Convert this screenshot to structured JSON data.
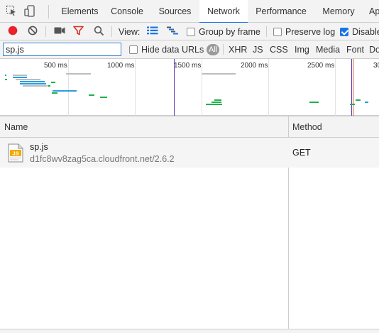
{
  "tabs": [
    {
      "label": "Elements",
      "active": false
    },
    {
      "label": "Console",
      "active": false
    },
    {
      "label": "Sources",
      "active": false
    },
    {
      "label": "Network",
      "active": true
    },
    {
      "label": "Performance",
      "active": false
    },
    {
      "label": "Memory",
      "active": false
    },
    {
      "label": "Ap",
      "active": false
    }
  ],
  "toolbar": {
    "record_icon": "record-icon",
    "clear_icon": "clear-icon",
    "camera_icon": "camera-icon",
    "filter_icon": "filter-icon",
    "search_icon": "search-icon",
    "view_label": "View:",
    "group_by_frame": {
      "label": "Group by frame",
      "checked": false
    },
    "preserve_log": {
      "label": "Preserve log",
      "checked": false
    },
    "disable_cache": {
      "label": "Disable",
      "checked": true
    }
  },
  "filter": {
    "value": "sp.js",
    "hide_data_urls": {
      "label": "Hide data URLs",
      "checked": false
    },
    "types": [
      "All",
      "XHR",
      "JS",
      "CSS",
      "Img",
      "Media",
      "Font",
      "Doc"
    ]
  },
  "overview": {
    "ticks": [
      "500 ms",
      "1000 ms",
      "1500 ms",
      "2000 ms",
      "2500 ms",
      "30"
    ]
  },
  "table": {
    "headers": {
      "name": "Name",
      "method": "Method"
    },
    "rows": [
      {
        "name": "sp.js",
        "path": "d1fc8wv8zag5ca.cloudfront.net/2.6.2",
        "method": "GET",
        "icon": "js-file-icon"
      }
    ]
  },
  "colors": {
    "accent": "#1a73e8",
    "record": "#e8232a",
    "filter": "#d93025",
    "bar_blue": "#2a9de0",
    "bar_green": "#21b14c",
    "marker_purple": "#5b38b2",
    "marker_red": "#d34b4b"
  }
}
